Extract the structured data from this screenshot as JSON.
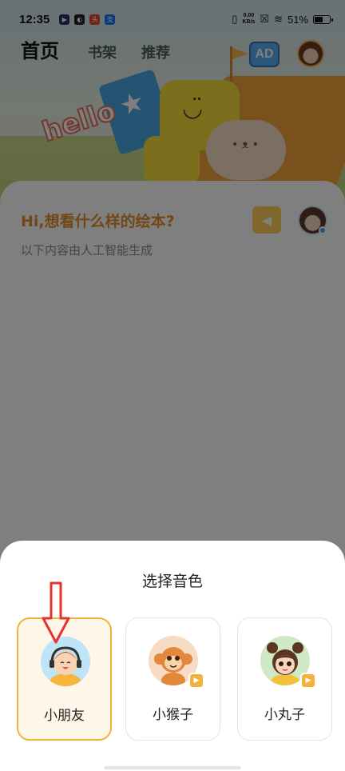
{
  "status_bar": {
    "time": "12:35",
    "net_speed_value": "0.00",
    "net_speed_unit": "KB/s",
    "battery": "51%",
    "battery_level": 0.51,
    "icons": [
      "video-app-icon",
      "browser-app-icon",
      "toutiao-app-icon",
      "alipay-app-icon",
      "vibrate-icon",
      "no-sim-icon",
      "wifi-icon",
      "battery-icon"
    ]
  },
  "nav": {
    "home": "首页",
    "shelf": "书架",
    "recommend": "推荐",
    "ad_label": "AD"
  },
  "header_scene": {
    "hello_text": "hello"
  },
  "main": {
    "greeting": "Hi,想看什么样的绘本?",
    "subtext": "以下内容由人工智能生成"
  },
  "sheet": {
    "title": "选择音色",
    "options": [
      {
        "name": "小朋友",
        "selected": true
      },
      {
        "name": "小猴子",
        "selected": false
      },
      {
        "name": "小丸子",
        "selected": false
      }
    ]
  },
  "colors": {
    "accent_orange": "#e0912a",
    "selected_border": "#f0b43a",
    "selected_bg": "#fff6ea",
    "annotation_red": "#e8302c"
  }
}
